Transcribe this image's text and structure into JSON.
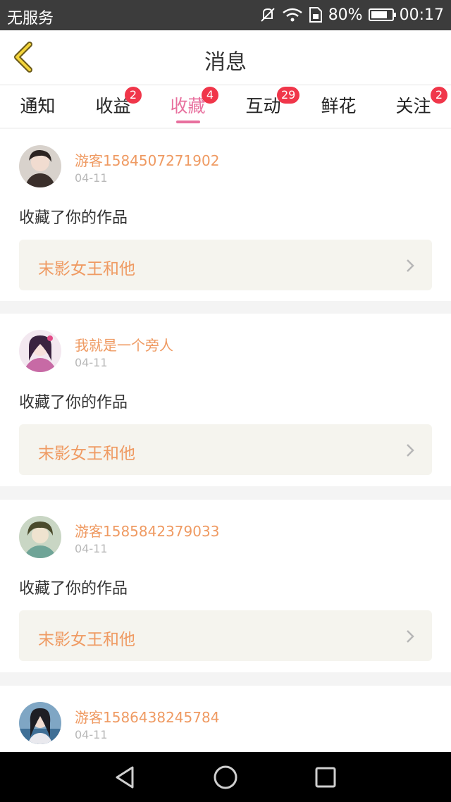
{
  "status_bar": {
    "carrier": "无服务",
    "battery": "80%",
    "battery_level": 0.8,
    "time": "00:17"
  },
  "header": {
    "title": "消息"
  },
  "tabs": [
    {
      "label": "通知",
      "badge": ""
    },
    {
      "label": "收益",
      "badge": "2"
    },
    {
      "label": "收藏",
      "badge": "4"
    },
    {
      "label": "互动",
      "badge": "29"
    },
    {
      "label": "鲜花",
      "badge": ""
    },
    {
      "label": "关注",
      "badge": "2"
    }
  ],
  "active_tab": "收藏",
  "colors": {
    "accent": "#e8709e",
    "name_color": "#ef9a62",
    "badge": "#f0364a"
  },
  "messages": [
    {
      "user": "游客1584507271902",
      "date": "04-11",
      "action": "收藏了你的作品",
      "work": "末影女王和他"
    },
    {
      "user": "我就是一个旁人",
      "date": "04-11",
      "action": "收藏了你的作品",
      "work": "末影女王和他"
    },
    {
      "user": "游客1585842379033",
      "date": "04-11",
      "action": "收藏了你的作品",
      "work": "末影女王和他"
    },
    {
      "user": "游客1586438245784",
      "date": "04-11",
      "action": "",
      "work": ""
    }
  ]
}
